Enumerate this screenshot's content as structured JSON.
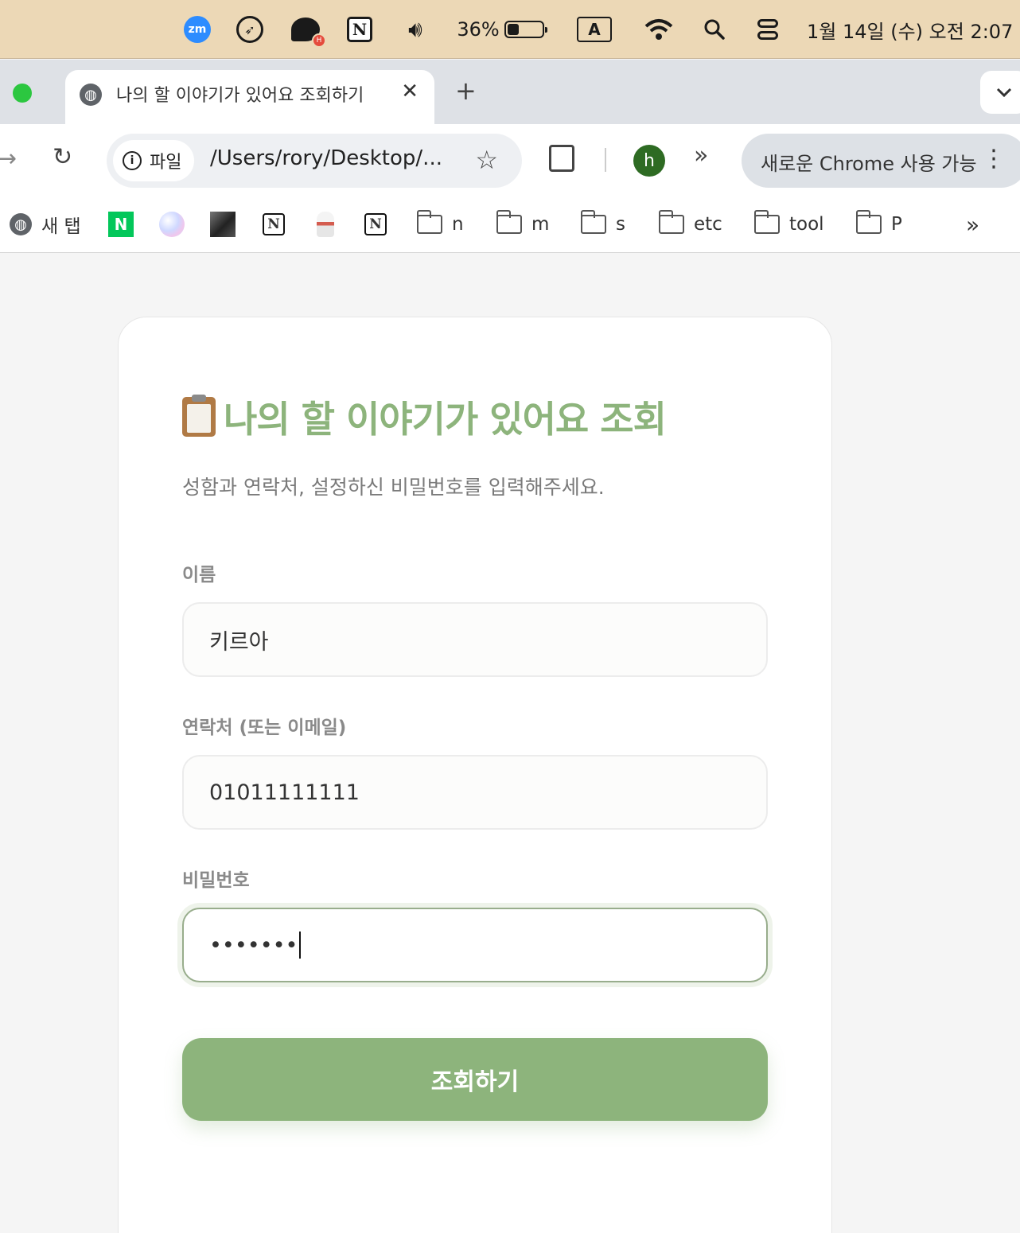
{
  "menubar": {
    "icons": [
      "zoom-icon",
      "rocket-icon",
      "chat-icon",
      "notion-icon",
      "volume-icon",
      "battery-icon",
      "input-source-icon",
      "wifi-icon",
      "search-icon",
      "control-center-icon"
    ],
    "zoom_label": "zm",
    "chat_badge": "H",
    "notion_letter": "N",
    "battery_percent": "36%",
    "input_source": "A",
    "datetime": "1월 14일 (수) 오전 2:07"
  },
  "tabs": [
    {
      "title": "나의 할 이야기가 있어요 조회하기",
      "close": "✕",
      "active": true
    }
  ],
  "new_tab": "+",
  "tab_search": "⌄",
  "toolbar": {
    "forward": "→",
    "reload": "↻",
    "site_chip_icon": "i",
    "site_chip": "파일",
    "url": "/Users/rory/Desktop/...",
    "bookmark_star": "☆",
    "profile_initial": "h",
    "overflow": "»",
    "update_pill": "새로운 Chrome 사용 가능",
    "menu": "⋮"
  },
  "bookmarks": {
    "new_tab": "새 탭",
    "naver_letter": "N",
    "notion_letter": "N",
    "folders": [
      "n",
      "m",
      "s",
      "etc",
      "tool",
      "P"
    ],
    "overflow": "»"
  },
  "form": {
    "title": "나의 할 이야기가 있어요 조회",
    "subtitle": "성함과 연락처, 설정하신 비밀번호를 입력해주세요.",
    "name_label": "이름",
    "name_value": "키르아",
    "contact_label": "연락처 (또는 이메일)",
    "contact_value": "01011111111",
    "password_label": "비밀번호",
    "password_value": "•••••••",
    "submit_label": "조회하기"
  },
  "colors": {
    "accent": "#8db47c",
    "menubar": "#ecd8b6",
    "profile": "#2e6b23"
  }
}
